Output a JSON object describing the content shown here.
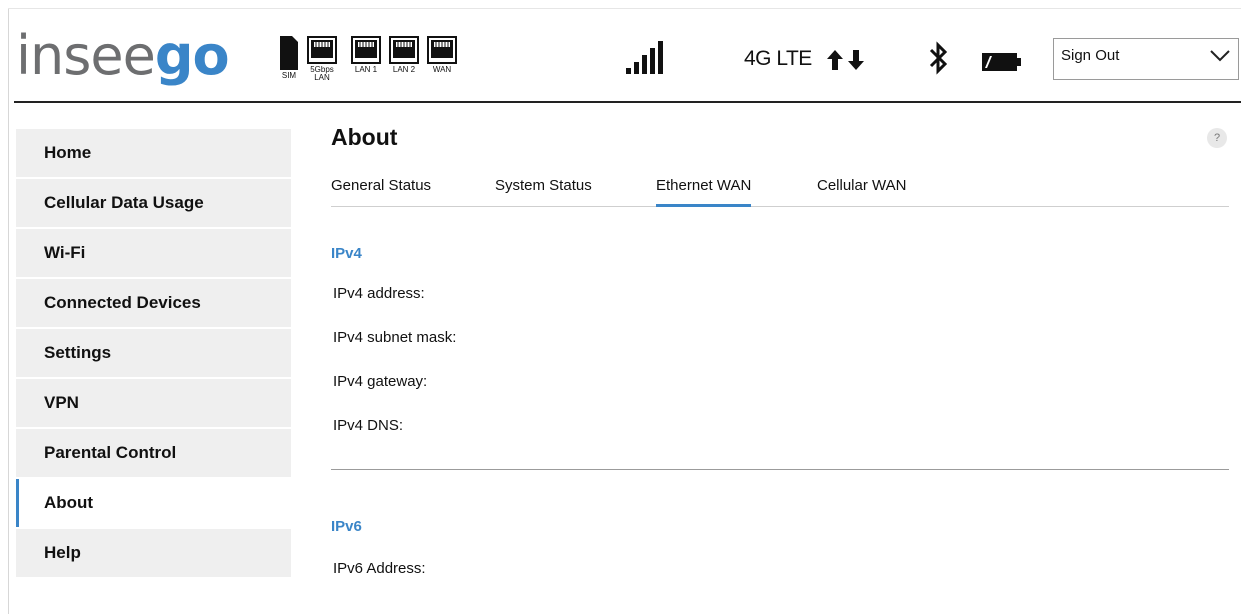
{
  "brand": {
    "part1": "insee",
    "part2": "go",
    "accent": "#3a85c8",
    "gray": "#6d6e70"
  },
  "header": {
    "ports": [
      {
        "label": "SIM",
        "icon": "sim-card-icon"
      },
      {
        "label": "5Gbps",
        "label2": "LAN",
        "icon": "ethernet-port-icon"
      },
      {
        "label": "LAN 1",
        "icon": "ethernet-port-icon"
      },
      {
        "label": "LAN 2",
        "icon": "ethernet-port-icon"
      },
      {
        "label": "WAN",
        "icon": "ethernet-port-icon"
      }
    ],
    "signal_icon": "signal-bars-icon",
    "network_label": "4G LTE",
    "arrows_icon": "up-down-arrows-icon",
    "bluetooth_icon": "bluetooth-icon",
    "battery_icon": "battery-icon",
    "signout": {
      "label": "Sign Out",
      "icon": "chevron-down-icon"
    }
  },
  "sidebar": {
    "items": [
      {
        "label": "Home"
      },
      {
        "label": "Cellular Data Usage"
      },
      {
        "label": "Wi-Fi"
      },
      {
        "label": "Connected Devices"
      },
      {
        "label": "Settings"
      },
      {
        "label": "VPN"
      },
      {
        "label": "Parental Control"
      },
      {
        "label": "About",
        "active": true
      },
      {
        "label": "Help"
      }
    ]
  },
  "main": {
    "title": "About",
    "help_label": "?",
    "tabs": [
      {
        "label": "General Status"
      },
      {
        "label": "System Status"
      },
      {
        "label": "Ethernet WAN",
        "active": true
      },
      {
        "label": "Cellular WAN"
      }
    ],
    "ipv4": {
      "title": "IPv4",
      "fields": [
        "IPv4 address:",
        "IPv4 subnet mask:",
        "IPv4 gateway:",
        "IPv4 DNS:"
      ]
    },
    "ipv6": {
      "title": "IPv6",
      "fields": [
        "IPv6 Address:"
      ]
    }
  }
}
